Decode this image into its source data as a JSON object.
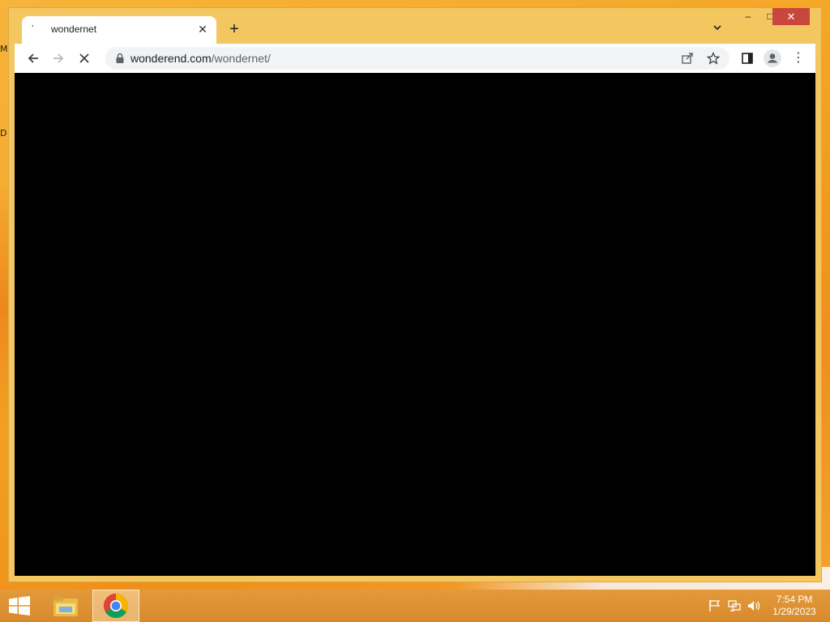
{
  "desktop": {
    "labels": [
      "M",
      "D"
    ]
  },
  "browser": {
    "tab": {
      "title": "wondernet",
      "close_glyph": "✕",
      "favicon_glyph": "ʼ"
    },
    "new_tab_glyph": "+",
    "tab_search_glyph": "⌄",
    "window_controls": {
      "minimize": "–",
      "maximize": "□",
      "close": "✕"
    },
    "toolbar": {
      "back_glyph": "←",
      "forward_glyph": "→",
      "stop_glyph": "✕",
      "url_domain": "wonderend.com",
      "url_path": "/wondernet/",
      "menu_glyph": "⋮"
    },
    "content": {
      "background": "#000000"
    }
  },
  "taskbar": {
    "clock_time": "7:54 PM",
    "clock_date": "1/29/2023",
    "items": [
      "file-explorer",
      "chrome"
    ],
    "active_item": "chrome"
  },
  "colors": {
    "window_frame": "#f3c65f",
    "close_button": "#c9463d",
    "taskbar": "#dd922f"
  }
}
